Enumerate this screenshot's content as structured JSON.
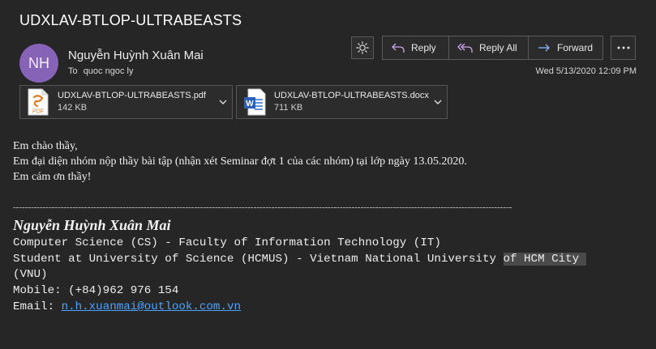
{
  "message": {
    "subject": "UDXLAV-BTLOP-ULTRABEASTS",
    "sender_initials": "NH",
    "sender_name": "Nguyễn Huỳnh Xuân Mai",
    "to_label": "To",
    "to_value": "quoc ngoc ly",
    "date": "Wed 5/13/2020 12:09 PM"
  },
  "actions": {
    "reply": "Reply",
    "reply_all": "Reply All",
    "forward": "Forward"
  },
  "attachments": [
    {
      "name": "UDXLAV-BTLOP-ULTRABEASTS.pdf",
      "size": "142 KB",
      "icon": "pdf-file-icon",
      "icon_label": "PDF"
    },
    {
      "name": "UDXLAV-BTLOP-ULTRABEASTS.docx",
      "size": "711 KB",
      "icon": "word-file-icon",
      "icon_label": "W"
    }
  ],
  "body": {
    "line1": "Em chào thầy,",
    "line2": "Em đại diện nhóm nộp thầy bài tập (nhận xét Seminar đợt 1 của các nhóm)  tại lớp ngày 13.05.2020.",
    "line3": "Em cám ơn thầy!"
  },
  "signature": {
    "divider": "------------------------------------------------------------------------------------------------------------------------------------------------------------------------",
    "name": "Nguyễn Huỳnh Xuân Mai",
    "line1": "Computer Science (CS) - Faculty of Information Technology (IT)",
    "line2_a": "Student at University of Science (HCMUS) - Vietnam National University ",
    "line2_b": "of HCM City ",
    "line3": "(VNU)",
    "line4": "Mobile: (+84)962 976 154",
    "email_label": "Email: ",
    "email": "n.h.xuanmai@outlook.com.vn"
  },
  "colors": {
    "background": "#262626",
    "avatar": "#8763b8",
    "link": "#4ea3ff",
    "reply_icon": "#c9a3e8",
    "forward_icon": "#8ab4ff"
  }
}
